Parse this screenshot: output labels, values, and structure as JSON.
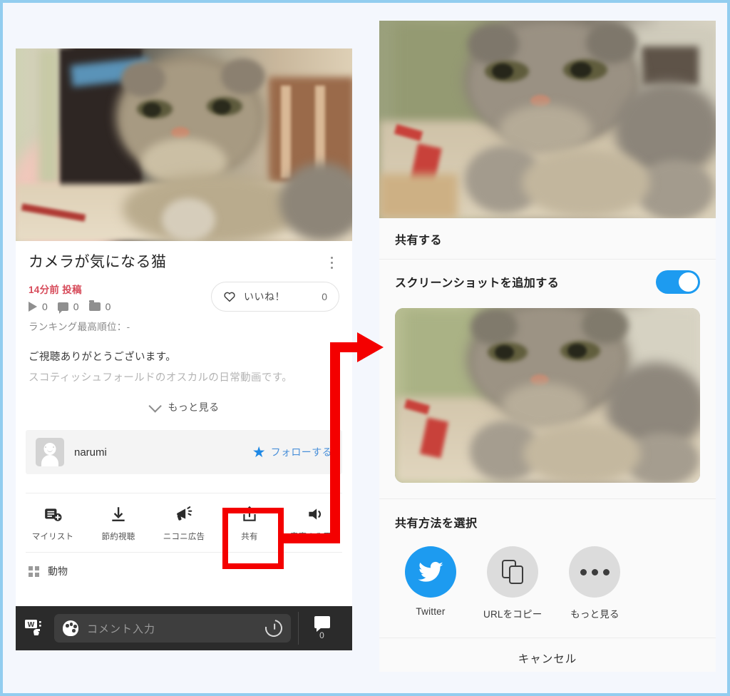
{
  "frame": {
    "border_color": "#92cdef",
    "background": "#f4f7fd"
  },
  "left_panel": {
    "video": {
      "alt": "cat-video-thumbnail"
    },
    "title": "カメラが気になる猫",
    "kebab_icon": "more-vertical-icon",
    "posted": "14分前 投稿",
    "stats": [
      {
        "icon": "play-icon",
        "value": "0"
      },
      {
        "icon": "comment-icon",
        "value": "0"
      },
      {
        "icon": "mylist-folder-icon",
        "value": "0"
      }
    ],
    "ranking": "ランキング最高順位：-",
    "like": {
      "icon": "heart-icon",
      "label": "いいね！",
      "count": "0"
    },
    "description": {
      "line1": "ご視聴ありがとうございます。",
      "line2": "スコティッシュフォールドのオスカルの日常動画です。"
    },
    "more": {
      "icon": "chevron-down-icon",
      "label": "もっと見る"
    },
    "author": {
      "avatar": "default-user-avatar",
      "name": "narumi",
      "follow_icon": "star-icon",
      "follow_label": "フォローする"
    },
    "actions": [
      {
        "icon": "mylist-add-icon",
        "label": "マイリスト"
      },
      {
        "icon": "download-icon",
        "label": "節約視聴"
      },
      {
        "icon": "megaphone-icon",
        "label": "ニコニ広告"
      },
      {
        "icon": "share-icon",
        "label": "共有"
      },
      {
        "icon": "audio-only-icon",
        "label": "音声のみ再生"
      }
    ],
    "tag": {
      "icon": "grid-icon",
      "label": "動物"
    },
    "comment_bar": {
      "type_icon": "comment-type-icon",
      "palette_icon": "palette-icon",
      "placeholder": "コメント入力",
      "history_icon": "history-icon",
      "count_icon": "comment-bubble-icon",
      "count": "0"
    }
  },
  "right_panel": {
    "video": {
      "alt": "cat-video-thumbnail"
    },
    "sheet_title": "共有する",
    "screenshot_toggle": {
      "label": "スクリーンショットを追加する",
      "state": "on",
      "color": "#1d9bf0"
    },
    "screenshot_preview": {
      "alt": "cat-screenshot-preview"
    },
    "share_section_title": "共有方法を選択",
    "share_options": [
      {
        "icon": "twitter-icon",
        "label": "Twitter",
        "color": "#1d9bf0"
      },
      {
        "icon": "copy-link-icon",
        "label": "URLをコピー",
        "color": "#dcdcdc"
      },
      {
        "icon": "more-horizontal-icon",
        "label": "もっと見る",
        "color": "#dcdcdc"
      }
    ],
    "cancel_label": "キャンセル"
  },
  "annotation": {
    "arrow_color": "#f40000",
    "highlight_target": "共有"
  }
}
